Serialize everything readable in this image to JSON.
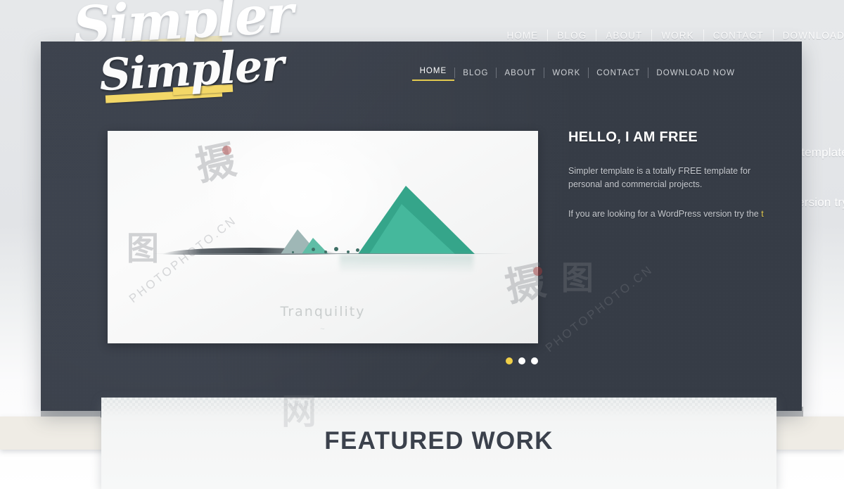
{
  "site": {
    "logo_text": "Simpler",
    "accent_yellow": "#f3d767",
    "dark_bg": "#393f4a",
    "page_bg": "#e6e8ea"
  },
  "nav": {
    "items": [
      {
        "label": "HOME",
        "active": true
      },
      {
        "label": "BLOG",
        "active": false
      },
      {
        "label": "ABOUT",
        "active": false
      },
      {
        "label": "WORK",
        "active": false
      },
      {
        "label": "CONTACT",
        "active": false
      },
      {
        "label": "DOWNLOAD NOW",
        "active": false
      }
    ]
  },
  "ghost": {
    "logo_text": "Simpler",
    "nav_items": [
      "HOME",
      "BLOG",
      "ABOUT",
      "WORK",
      "CONTACT",
      "DOWNLOAD"
    ],
    "right_text_1": "template",
    "right_text_2": "ersion try",
    "featured_title": "FEATURED WORK"
  },
  "hero": {
    "slide": {
      "caption": "Tranquility",
      "signature": "~",
      "mountain_color": "#35a58a"
    },
    "dots": [
      {
        "active": true
      },
      {
        "active": false
      },
      {
        "active": false
      }
    ],
    "heading": "HELLO, I AM FREE",
    "paragraph_1": "Simpler template is a totally FREE template for personal and commercial projects.",
    "paragraph_2_before": "If you are looking for a WordPress version try the ",
    "paragraph_2_link": "t"
  },
  "featured": {
    "title": "FEATURED WORK"
  },
  "watermark": {
    "text": "PHOTOPHOTO.CN",
    "glyph_a": "摄",
    "glyph_b": "图",
    "glyph_c": "网"
  }
}
